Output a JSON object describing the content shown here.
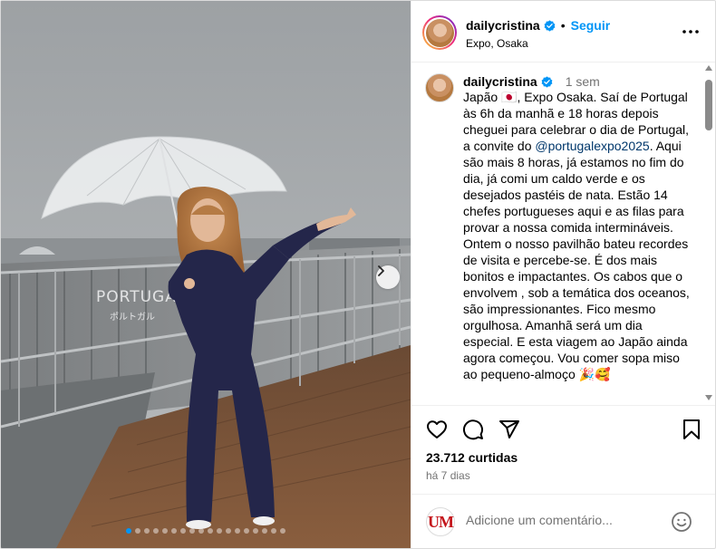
{
  "post": {
    "author": "dailycristina",
    "follow_label": "Seguir",
    "separator": "•",
    "location": "Expo, Osaka",
    "time_ago": "1 sem",
    "caption_before_mention": "Japão 🇯🇵, Expo Osaka. Saí de Portugal às 6h da manhã e 18 horas depois cheguei para celebrar o dia de Portugal, a convite do ",
    "caption_mention": "@portugalexpo2025",
    "caption_after_mention": ". Aqui são mais 8 horas, já estamos no fim do dia, já comi um caldo verde e os desejados pastéis de nata. Estão 14 chefes portugueses aqui e as filas para provar a nossa comida intermináveis. Ontem o nosso pavilhão bateu recordes de visita e percebe-se. É dos mais bonitos e impactantes. Os cabos que o envolvem , sob a temática dos oceanos, são impressionantes. Fico mesmo orgulhosa. Amanhã será um dia especial. E esta viagem ao Japão ainda agora começou. Vou comer sopa miso ao pequeno-almoço 🎉🥰",
    "likes": "23.712 curtidas",
    "date": "há 7 dias",
    "comment_placeholder": "Adicione um comentário...",
    "commenter_avatar_text": "UM",
    "media": {
      "pavilion_sign": "PORTUGAL",
      "pavilion_sign_jp": "ポルトガル",
      "carousel_total": 18,
      "carousel_active": 0
    }
  },
  "colors": {
    "accent": "#0095f6",
    "verified": "#0095f6",
    "mention": "#00376b",
    "muted": "#737373"
  },
  "icons": {
    "more": "more-horizontal-icon",
    "like": "heart-icon",
    "comment": "comment-bubble-icon",
    "share": "paper-plane-icon",
    "save": "bookmark-icon",
    "emoji": "smiley-icon",
    "next": "chevron-right-icon",
    "verified": "verified-badge-icon"
  }
}
